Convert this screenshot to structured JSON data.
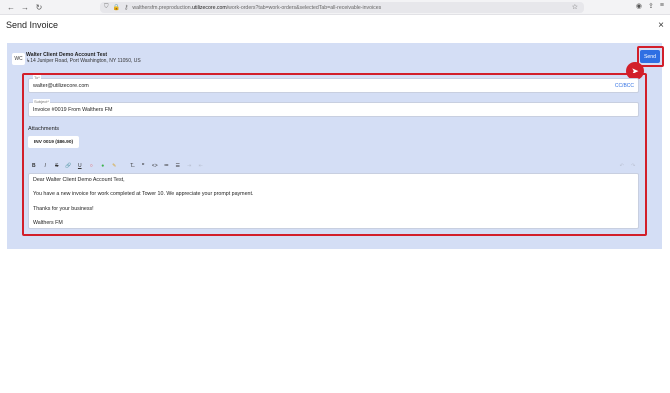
{
  "browser": {
    "url_prefix": "walthersfm.preproduction.",
    "url_domain": "utilizecore.com",
    "url_path": "/work-orders?tab=work-orders&selectedTab=all-receivable-invoices",
    "back_icon": "arrow-left-icon",
    "forward_icon": "arrow-right-icon",
    "reload_icon": "reload-icon"
  },
  "page": {
    "title": "Send Invoice",
    "close_label": "×"
  },
  "client": {
    "initials": "WC",
    "name": "Walter Client Demo Account Test",
    "address": "↳14 Juniper Road, Port Washington, NY 11050, US"
  },
  "send_button": {
    "label": "Send"
  },
  "to_field": {
    "label": "To*",
    "value": "walter@utilizecore.com",
    "cc_bcc": "CC/BCC"
  },
  "subject_field": {
    "label": "Subject*",
    "value": "Invoice #0019 From Walthers FM"
  },
  "attachments": {
    "label": "Attachments",
    "items": [
      "INV 0019 ($86.90)"
    ]
  },
  "toolbar": {
    "bold": "B",
    "italic": "I",
    "strike": "S",
    "link": "🔗",
    "underline": "U",
    "text_color": "○",
    "highlight": "●",
    "marker": "✎",
    "clear_format": "T̶",
    "quote": "❞",
    "code": "<>",
    "bullet_list": "≔",
    "ordered_list": "☰",
    "indent": "⇥",
    "outdent": "⇤",
    "undo": "↶",
    "redo": "↷"
  },
  "email_body": {
    "greeting": "Dear Walter Client Demo Account Test,",
    "message": "You have a new invoice for work completed at Tower 10. We appreciate your prompt payment.",
    "thanks": "Thanks for your business!",
    "signature": "Walthers FM"
  },
  "colors": {
    "panel_bg": "#d4def5",
    "accent": "#2f6fe3",
    "highlight_frame": "#d21f2a"
  }
}
